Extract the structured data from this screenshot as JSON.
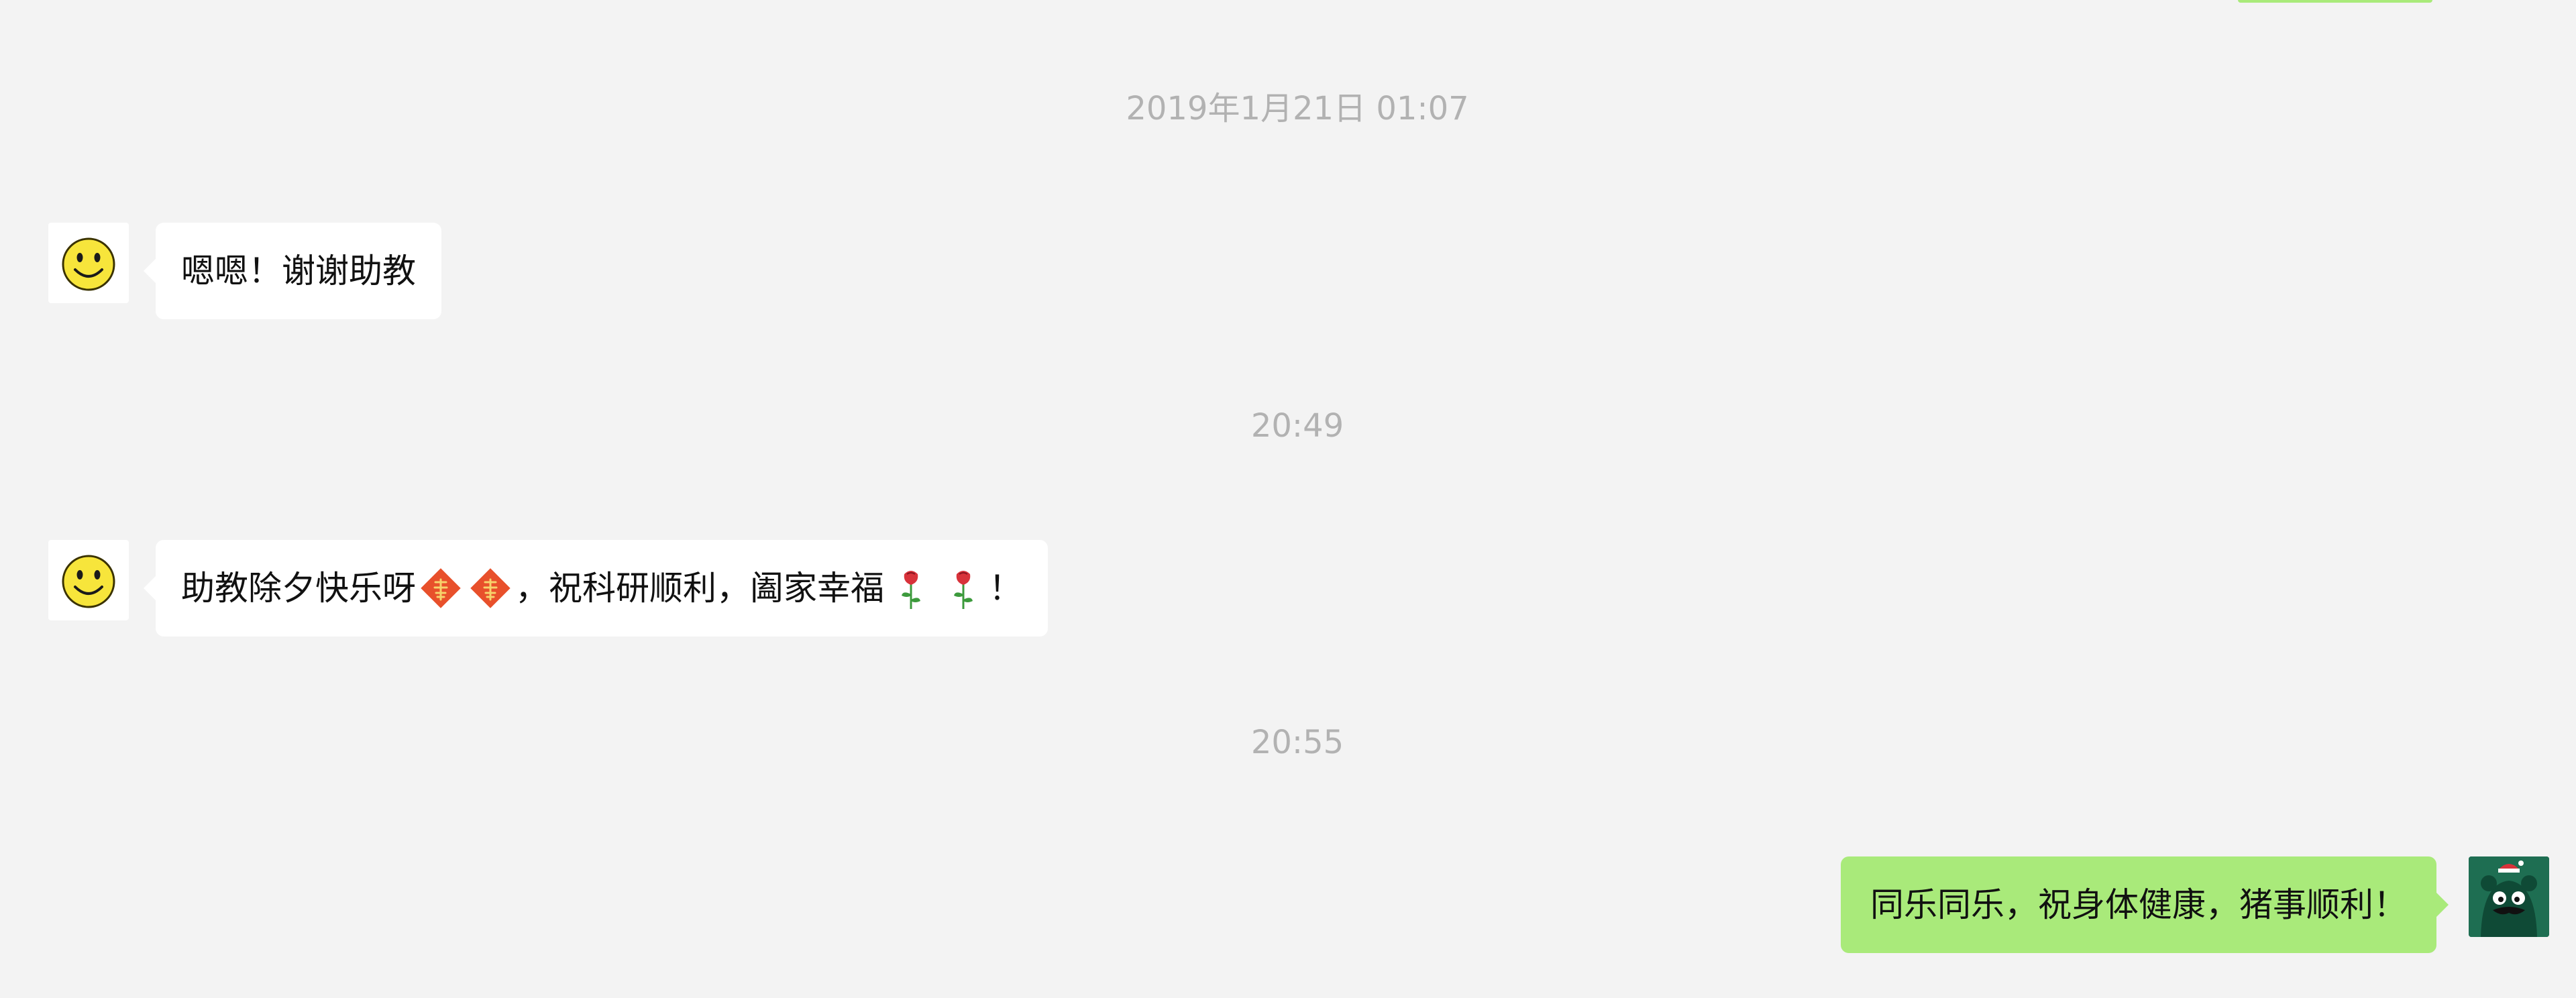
{
  "window": {
    "title": ""
  },
  "timestamps": [
    {
      "label": "2019年1月21日 01:07"
    },
    {
      "label": "20:49"
    },
    {
      "label": "20:55"
    }
  ],
  "messages": [
    {
      "side": "left",
      "avatar_icon": "smiley-face-icon",
      "text": "嗯嗯！谢谢助教"
    },
    {
      "side": "left",
      "avatar_icon": "smiley-face-icon",
      "parts": {
        "before": "助教除夕快乐呀",
        "fu_icon": "fu-blessing-icon",
        "middle": "，祝科研顺利，阖家幸福",
        "rose_icon": "rose-icon",
        "end": "！"
      }
    },
    {
      "side": "right",
      "avatar_icon": "green-monster-avatar-icon",
      "text": "同乐同乐，祝身体健康，猪事顺利！"
    }
  ],
  "colors": {
    "background": "#f3f3f3",
    "incoming_bubble": "#ffffff",
    "outgoing_bubble": "#a9ea7a",
    "timestamp_text": "#b2b2b2",
    "message_text": "#111111",
    "fu_diamond": "#e8502b",
    "fu_text": "#f7d26b",
    "rose_red": "#d8323a",
    "rose_stem": "#3c9a3c"
  }
}
